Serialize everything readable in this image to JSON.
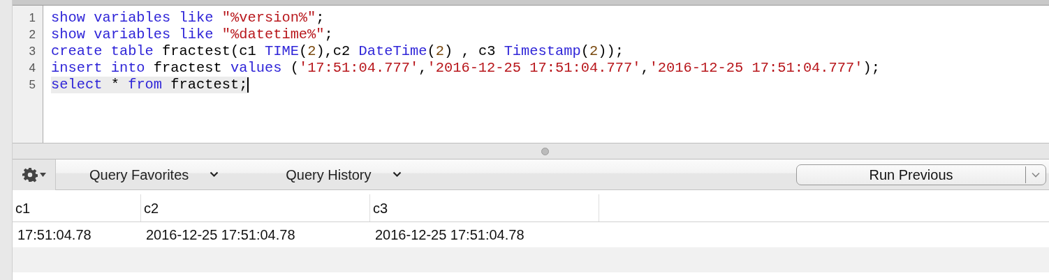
{
  "editor": {
    "lines": [
      {
        "number": "1",
        "current": false,
        "tokens": [
          {
            "kind": "keyword",
            "text": "show variables like "
          },
          {
            "kind": "string",
            "text": "\"%version%\""
          },
          {
            "kind": "plain",
            "text": ";"
          }
        ]
      },
      {
        "number": "2",
        "current": false,
        "tokens": [
          {
            "kind": "keyword",
            "text": "show variables like "
          },
          {
            "kind": "string",
            "text": "\"%datetime%\""
          },
          {
            "kind": "plain",
            "text": ";"
          }
        ]
      },
      {
        "number": "3",
        "current": false,
        "tokens": [
          {
            "kind": "keyword",
            "text": "create table"
          },
          {
            "kind": "plain",
            "text": " fractest(c1 "
          },
          {
            "kind": "keyword",
            "text": "TIME"
          },
          {
            "kind": "plain",
            "text": "("
          },
          {
            "kind": "number",
            "text": "2"
          },
          {
            "kind": "plain",
            "text": "),c2 "
          },
          {
            "kind": "keyword",
            "text": "DateTime"
          },
          {
            "kind": "plain",
            "text": "("
          },
          {
            "kind": "number",
            "text": "2"
          },
          {
            "kind": "plain",
            "text": ") , c3 "
          },
          {
            "kind": "keyword",
            "text": "Timestamp"
          },
          {
            "kind": "plain",
            "text": "("
          },
          {
            "kind": "number",
            "text": "2"
          },
          {
            "kind": "plain",
            "text": "));"
          }
        ]
      },
      {
        "number": "4",
        "current": false,
        "tokens": [
          {
            "kind": "keyword",
            "text": "insert into"
          },
          {
            "kind": "plain",
            "text": " fractest "
          },
          {
            "kind": "keyword",
            "text": "values"
          },
          {
            "kind": "plain",
            "text": " ("
          },
          {
            "kind": "string",
            "text": "'17:51:04.777'"
          },
          {
            "kind": "plain",
            "text": ","
          },
          {
            "kind": "string",
            "text": "'2016-12-25 17:51:04.777'"
          },
          {
            "kind": "plain",
            "text": ","
          },
          {
            "kind": "string",
            "text": "'2016-12-25 17:51:04.777'"
          },
          {
            "kind": "plain",
            "text": ");"
          }
        ]
      },
      {
        "number": "5",
        "current": true,
        "tokens": [
          {
            "kind": "keyword",
            "text": "select"
          },
          {
            "kind": "plain",
            "text": " * "
          },
          {
            "kind": "keyword",
            "text": "from"
          },
          {
            "kind": "plain",
            "text": " fractest;"
          }
        ]
      }
    ]
  },
  "toolbar": {
    "menus": [
      "Query Favorites",
      "Query History"
    ],
    "run_button": "Run Previous"
  },
  "table": {
    "columns": [
      "c1",
      "c2",
      "c3"
    ],
    "rows": [
      [
        "17:51:04.78",
        "2016-12-25 17:51:04.78",
        "2016-12-25 17:51:04.78"
      ]
    ]
  }
}
